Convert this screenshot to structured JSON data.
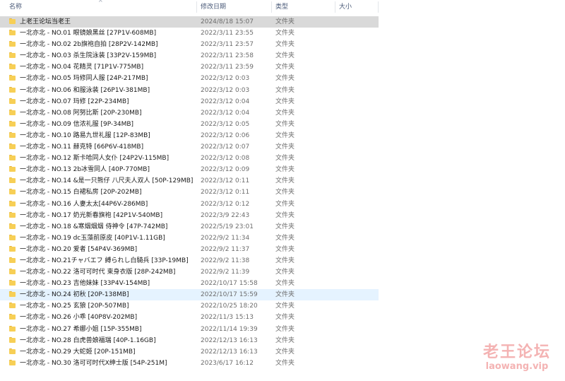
{
  "columns": {
    "name": "名称",
    "date": "修改日期",
    "type": "类型",
    "size": "大小"
  },
  "sort_arrow": "^",
  "files": [
    {
      "name": "上老王论坛当老王",
      "date": "2024/8/18 15:07",
      "type": "文件夹"
    },
    {
      "name": "一北亦北 - NO.01 眼镜娘黑丝 [27P1V-608MB]",
      "date": "2022/3/11 23:55",
      "type": "文件夹"
    },
    {
      "name": "一北亦北 - NO.02 2b旗袍自拍 [28P2V-142MB]",
      "date": "2022/3/11 23:57",
      "type": "文件夹"
    },
    {
      "name": "一北亦北 - NO.03 杀生院泳装 [33P2V-159MB]",
      "date": "2022/3/11 23:58",
      "type": "文件夹"
    },
    {
      "name": "一北亦北 - NO.04 花精灵 [71P1V-775MB]",
      "date": "2022/3/11 23:59",
      "type": "文件夹"
    },
    {
      "name": "一北亦北 - NO.05 玛修同人服 [24P-217MB]",
      "date": "2022/3/12 0:03",
      "type": "文件夹"
    },
    {
      "name": "一北亦北 - NO.06 和服泳装 [26P1V-381MB]",
      "date": "2022/3/12 0:03",
      "type": "文件夹"
    },
    {
      "name": "一北亦北 - NO.07 玛修 [22P-234MB]",
      "date": "2022/3/12 0:04",
      "type": "文件夹"
    },
    {
      "name": "一北亦北 - NO.08 阿努比斯 [20P-230MB]",
      "date": "2022/3/12 0:04",
      "type": "文件夹"
    },
    {
      "name": "一北亦北 - NO.09 信浓礼服 [9P-34MB]",
      "date": "2022/3/12 0:05",
      "type": "文件夹"
    },
    {
      "name": "一北亦北 - NO.10 路易九世礼服 [12P-83MB]",
      "date": "2022/3/12 0:06",
      "type": "文件夹"
    },
    {
      "name": "一北亦北 - NO.11 赫克特 [66P6V-418MB]",
      "date": "2022/3/12 0:07",
      "type": "文件夹"
    },
    {
      "name": "一北亦北 - NO.12 斯卡哈同人女仆 [24P2V-115MB]",
      "date": "2022/3/12 0:08",
      "type": "文件夹"
    },
    {
      "name": "一北亦北 - NO.13 2b冰雪同人 [40P-770MB]",
      "date": "2022/3/12 0:09",
      "type": "文件夹"
    },
    {
      "name": "一北亦北 - NO.14 &是一只熊仔 八尺夫人双人 [50P-129MB]",
      "date": "2022/3/12 0:11",
      "type": "文件夹"
    },
    {
      "name": "一北亦北 - NO.15 白裙私房 [20P-202MB]",
      "date": "2022/3/12 0:11",
      "type": "文件夹"
    },
    {
      "name": "一北亦北 - NO.16 人妻太太[44P6V-286MB]",
      "date": "2022/3/12 0:12",
      "type": "文件夹"
    },
    {
      "name": "一北亦北 - NO.17 奶光新春旗袍 [42P1V-540MB]",
      "date": "2022/3/9 22:43",
      "type": "文件夹"
    },
    {
      "name": "一北亦北 - NO.18 &寒烟烟烟 侍神令 [47P-742MB]",
      "date": "2022/5/19 23:01",
      "type": "文件夹"
    },
    {
      "name": "一北亦北 - NO.19 dc玉藻前原皮 [40P1V-1.11GB]",
      "date": "2022/9/2 11:34",
      "type": "文件夹"
    },
    {
      "name": "一北亦北 - NO.20 爱者 [54P4V-369MB]",
      "date": "2022/9/2 11:37",
      "type": "文件夹"
    },
    {
      "name": "一北亦北 - NO.21チャバエフ 縛られし白騎兵 [33P-19MB]",
      "date": "2022/9/2 11:38",
      "type": "文件夹"
    },
    {
      "name": "一北亦北 - NO.22 洛可可时代 束身衣版 [28P-242MB]",
      "date": "2022/9/2 11:39",
      "type": "文件夹"
    },
    {
      "name": "一北亦北 - NO.23 吉他妹妹 [33P4V-154MB]",
      "date": "2022/10/17 15:58",
      "type": "文件夹"
    },
    {
      "name": "一北亦北 - NO.24 初秋 [20P-138MB]",
      "date": "2022/10/17 15:59",
      "type": "文件夹"
    },
    {
      "name": "一北亦北 - NO.25 玄狼 [20P-507MB]",
      "date": "2022/10/25 18:20",
      "type": "文件夹"
    },
    {
      "name": "一北亦北 - NO.26 小乖 [40P8V-202MB]",
      "date": "2022/11/3 15:13",
      "type": "文件夹"
    },
    {
      "name": "一北亦北 - NO.27 希娜小姐 [15P-355MB]",
      "date": "2022/11/14 19:39",
      "type": "文件夹"
    },
    {
      "name": "一北亦北 - NO.28 白虎兽娘福瑞 [40P-1.16GB]",
      "date": "2022/12/13 16:13",
      "type": "文件夹"
    },
    {
      "name": "一北亦北 - NO.29 大蛇姬 [20P-151MB]",
      "date": "2022/12/13 16:13",
      "type": "文件夹"
    },
    {
      "name": "一北亦北 - NO.30 洛可可时代X绅士版 [54P-251M]",
      "date": "2023/6/17 16:12",
      "type": "文件夹"
    }
  ],
  "selected_index": 0,
  "hover_index": 24,
  "colors": {
    "selected_row": "#d9d9d9",
    "hover_row": "#e5f3ff",
    "folder": "#f7cf56",
    "watermark": "#f4b3b3"
  },
  "watermark": {
    "title": "老王论坛",
    "url": "laowang.vip"
  }
}
